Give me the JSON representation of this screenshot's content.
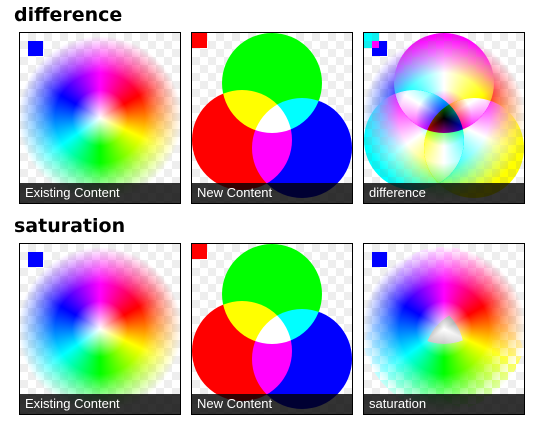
{
  "sections": [
    {
      "title": "difference",
      "captions": [
        "Existing Content",
        "New Content",
        "difference"
      ]
    },
    {
      "title": "saturation",
      "captions": [
        "Existing Content",
        "New Content",
        "saturation"
      ]
    }
  ],
  "colors": {
    "red": "#ff0000",
    "green": "#00ff00",
    "blue": "#0000ff",
    "caption_bg": "rgba(0,0,0,0.8)"
  }
}
